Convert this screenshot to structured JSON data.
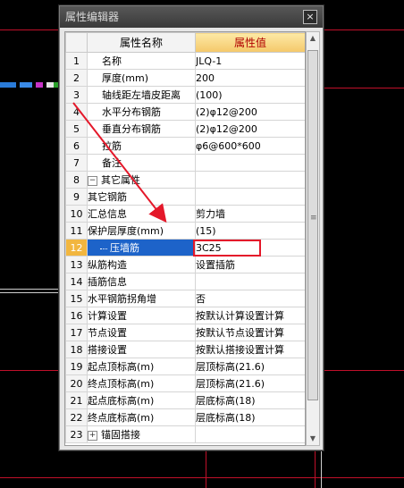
{
  "window": {
    "title": "属性编辑器",
    "close_glyph": "×"
  },
  "grid": {
    "header": {
      "name": "属性名称",
      "value": "属性值"
    },
    "rows": [
      {
        "num": "1",
        "name": "名称",
        "value": "JLQ-1"
      },
      {
        "num": "2",
        "name": "厚度(mm)",
        "value": "200"
      },
      {
        "num": "3",
        "name": "轴线距左墙皮距离",
        "value": "(100)"
      },
      {
        "num": "4",
        "name": "水平分布钢筋",
        "value": "(2)φ12@200"
      },
      {
        "num": "5",
        "name": "垂直分布钢筋",
        "value": "(2)φ12@200"
      },
      {
        "num": "6",
        "name": "拉筋",
        "value": "φ6@600*600"
      },
      {
        "num": "7",
        "name": "备注",
        "value": ""
      },
      {
        "num": "8",
        "name": "其它属性",
        "value": ""
      },
      {
        "num": "9",
        "name": "其它钢筋",
        "value": ""
      },
      {
        "num": "10",
        "name": "汇总信息",
        "value": "剪力墙"
      },
      {
        "num": "11",
        "name": "保护层厚度(mm)",
        "value": "(15)"
      },
      {
        "num": "12",
        "name": "压墙筋",
        "value": "3C25"
      },
      {
        "num": "13",
        "name": "纵筋构造",
        "value": "设置插筋"
      },
      {
        "num": "14",
        "name": "插筋信息",
        "value": ""
      },
      {
        "num": "15",
        "name": "水平钢筋拐角增",
        "value": "否"
      },
      {
        "num": "16",
        "name": "计算设置",
        "value": "按默认计算设置计算"
      },
      {
        "num": "17",
        "name": "节点设置",
        "value": "按默认节点设置计算"
      },
      {
        "num": "18",
        "name": "搭接设置",
        "value": "按默认搭接设置计算"
      },
      {
        "num": "19",
        "name": "起点顶标高(m)",
        "value": "层顶标高(21.6)"
      },
      {
        "num": "20",
        "name": "终点顶标高(m)",
        "value": "层顶标高(21.6)"
      },
      {
        "num": "21",
        "name": "起点底标高(m)",
        "value": "层底标高(18)"
      },
      {
        "num": "22",
        "name": "终点底标高(m)",
        "value": "层底标高(18)"
      },
      {
        "num": "23",
        "name": "锚固搭接",
        "value": ""
      }
    ],
    "selected_row": "12",
    "expand_minus": "−",
    "expand_plus": "+"
  },
  "colors": {
    "annotation": "#e4182a",
    "selection": "#1d63c9",
    "header_value_bg": "#f4c86a"
  }
}
